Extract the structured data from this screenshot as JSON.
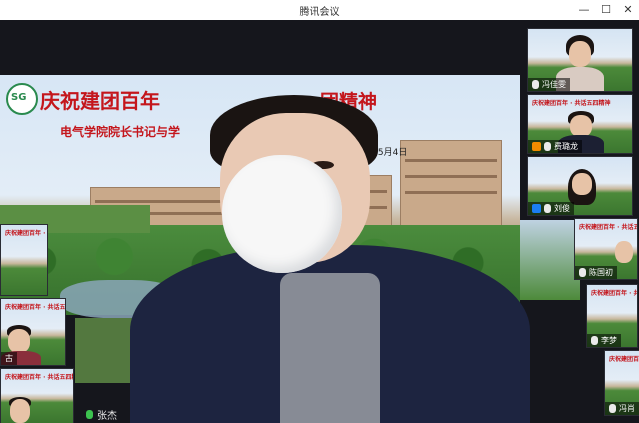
{
  "window": {
    "title": "腾讯会议",
    "minimize": "—",
    "maximize": "☐",
    "close": "✕"
  },
  "slide": {
    "logo_text": "SG",
    "headline_left": "庆祝建团百年",
    "headline_right": "团精神",
    "subline": "电气学院院长书记与学",
    "date": "2022年5月4日"
  },
  "mini_slide": {
    "title": "庆祝建团百年 · 共话五四精神"
  },
  "main_speaker": {
    "name": "张杰"
  },
  "participants": [
    {
      "name": "冯佳雯"
    },
    {
      "name": "费璐龙"
    },
    {
      "name": "刘俊"
    },
    {
      "name": "陈国初"
    },
    {
      "name": "李梦"
    },
    {
      "name": "冯肖"
    },
    {
      "name": "古"
    }
  ],
  "colors": {
    "title_red": "#c4161c",
    "mic_active": "#3cc24f"
  }
}
